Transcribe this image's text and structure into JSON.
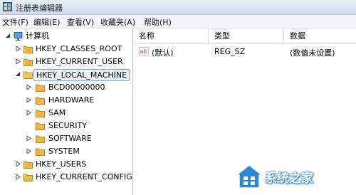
{
  "window": {
    "title": "注册表编辑器"
  },
  "menu": [
    "文件(F)",
    "编辑(E)",
    "查看(V)",
    "收藏夹(A)",
    "帮助(H)"
  ],
  "tree": {
    "root": "计算机",
    "hives": [
      "HKEY_CLASSES_ROOT",
      "HKEY_CURRENT_USER",
      "HKEY_LOCAL_MACHINE",
      "HKEY_USERS",
      "HKEY_CURRENT_CONFIG"
    ],
    "hklm_children": [
      "BCD00000000",
      "HARDWARE",
      "SAM",
      "SECURITY",
      "SOFTWARE",
      "SYSTEM"
    ]
  },
  "list": {
    "columns": [
      "名称",
      "类型",
      "数据"
    ],
    "rows": [
      {
        "name": "(默认)",
        "type": "REG_SZ",
        "data": "(数值未设置)"
      }
    ]
  },
  "watermark": {
    "text": "系统之家"
  },
  "colors": {
    "selection_border": "#7da2ce",
    "folder": "#e8b84a",
    "title_bar": "#dbe5f1"
  }
}
